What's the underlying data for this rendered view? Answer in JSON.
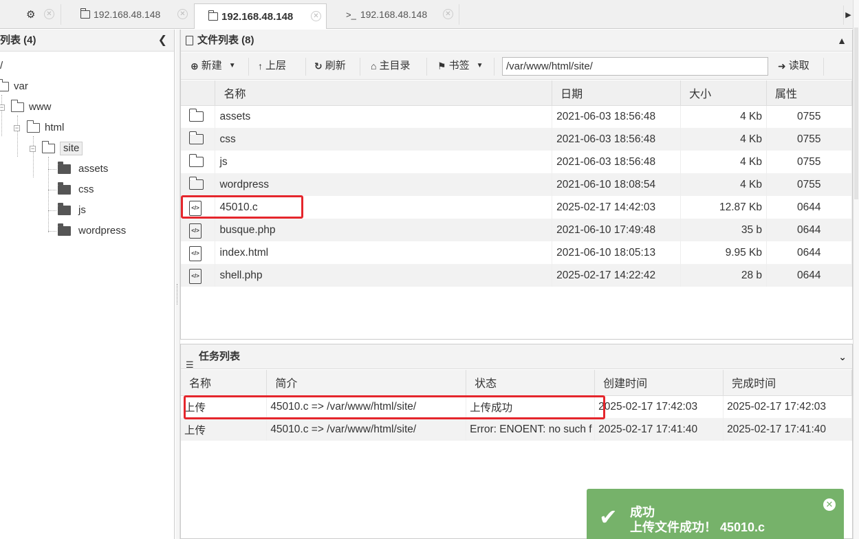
{
  "tabs": [
    {
      "label": "",
      "icon": "gear-icon"
    },
    {
      "label": "192.168.48.148",
      "icon": "folder-icon"
    },
    {
      "label": "192.168.48.148",
      "icon": "folder-icon",
      "active": true
    },
    {
      "label": "192.168.48.148",
      "icon": "terminal-icon",
      "prefix": ">_"
    }
  ],
  "left_panel": {
    "title": "列表 (4)",
    "tree": {
      "root": "/",
      "var": "var",
      "www": "www",
      "html": "html",
      "site": "site",
      "children": [
        "assets",
        "css",
        "js",
        "wordpress"
      ]
    }
  },
  "file_panel": {
    "title": "文件列表 (8)",
    "toolbar": {
      "new": "新建",
      "up": "上层",
      "refresh": "刷新",
      "home": "主目录",
      "bookmark": "书签",
      "path": "/var/www/html/site/",
      "read": "读取"
    },
    "columns": [
      "名称",
      "日期",
      "大小",
      "属性"
    ],
    "files": [
      {
        "type": "folder",
        "name": "assets",
        "date": "2021-06-03 18:56:48",
        "size": "4 Kb",
        "attr": "0755"
      },
      {
        "type": "folder",
        "name": "css",
        "date": "2021-06-03 18:56:48",
        "size": "4 Kb",
        "attr": "0755"
      },
      {
        "type": "folder",
        "name": "js",
        "date": "2021-06-03 18:56:48",
        "size": "4 Kb",
        "attr": "0755"
      },
      {
        "type": "folder",
        "name": "wordpress",
        "date": "2021-06-10 18:08:54",
        "size": "4 Kb",
        "attr": "0755"
      },
      {
        "type": "code",
        "name": "45010.c",
        "date": "2025-02-17 14:42:03",
        "size": "12.87 Kb",
        "attr": "0644"
      },
      {
        "type": "code",
        "name": "busque.php",
        "date": "2021-06-10 17:49:48",
        "size": "35 b",
        "attr": "0644"
      },
      {
        "type": "code",
        "name": "index.html",
        "date": "2021-06-10 18:05:13",
        "size": "9.95 Kb",
        "attr": "0644"
      },
      {
        "type": "code",
        "name": "shell.php",
        "date": "2025-02-17 14:22:42",
        "size": "28 b",
        "attr": "0644"
      }
    ]
  },
  "task_panel": {
    "title": "任务列表",
    "columns": [
      "名称",
      "简介",
      "状态",
      "创建时间",
      "完成时间"
    ],
    "tasks": [
      {
        "name": "上传",
        "desc": "45010.c => /var/www/html/site/",
        "status": "上传成功",
        "status_kind": "ok",
        "created": "2025-02-17 17:42:03",
        "finished": "2025-02-17 17:42:03"
      },
      {
        "name": "上传",
        "desc": "45010.c => /var/www/html/site/",
        "status": "Error: ENOENT: no such f",
        "status_kind": "error",
        "created": "2025-02-17 17:41:40",
        "finished": "2025-02-17 17:41:40"
      }
    ]
  },
  "toast": {
    "title": "成功",
    "message": "上传文件成功！ 45010.c",
    "color": "#76b26a"
  },
  "colors": {
    "highlight_box": "#e5262c",
    "success_text": "#2e8b1e",
    "error_text": "#e02020"
  }
}
